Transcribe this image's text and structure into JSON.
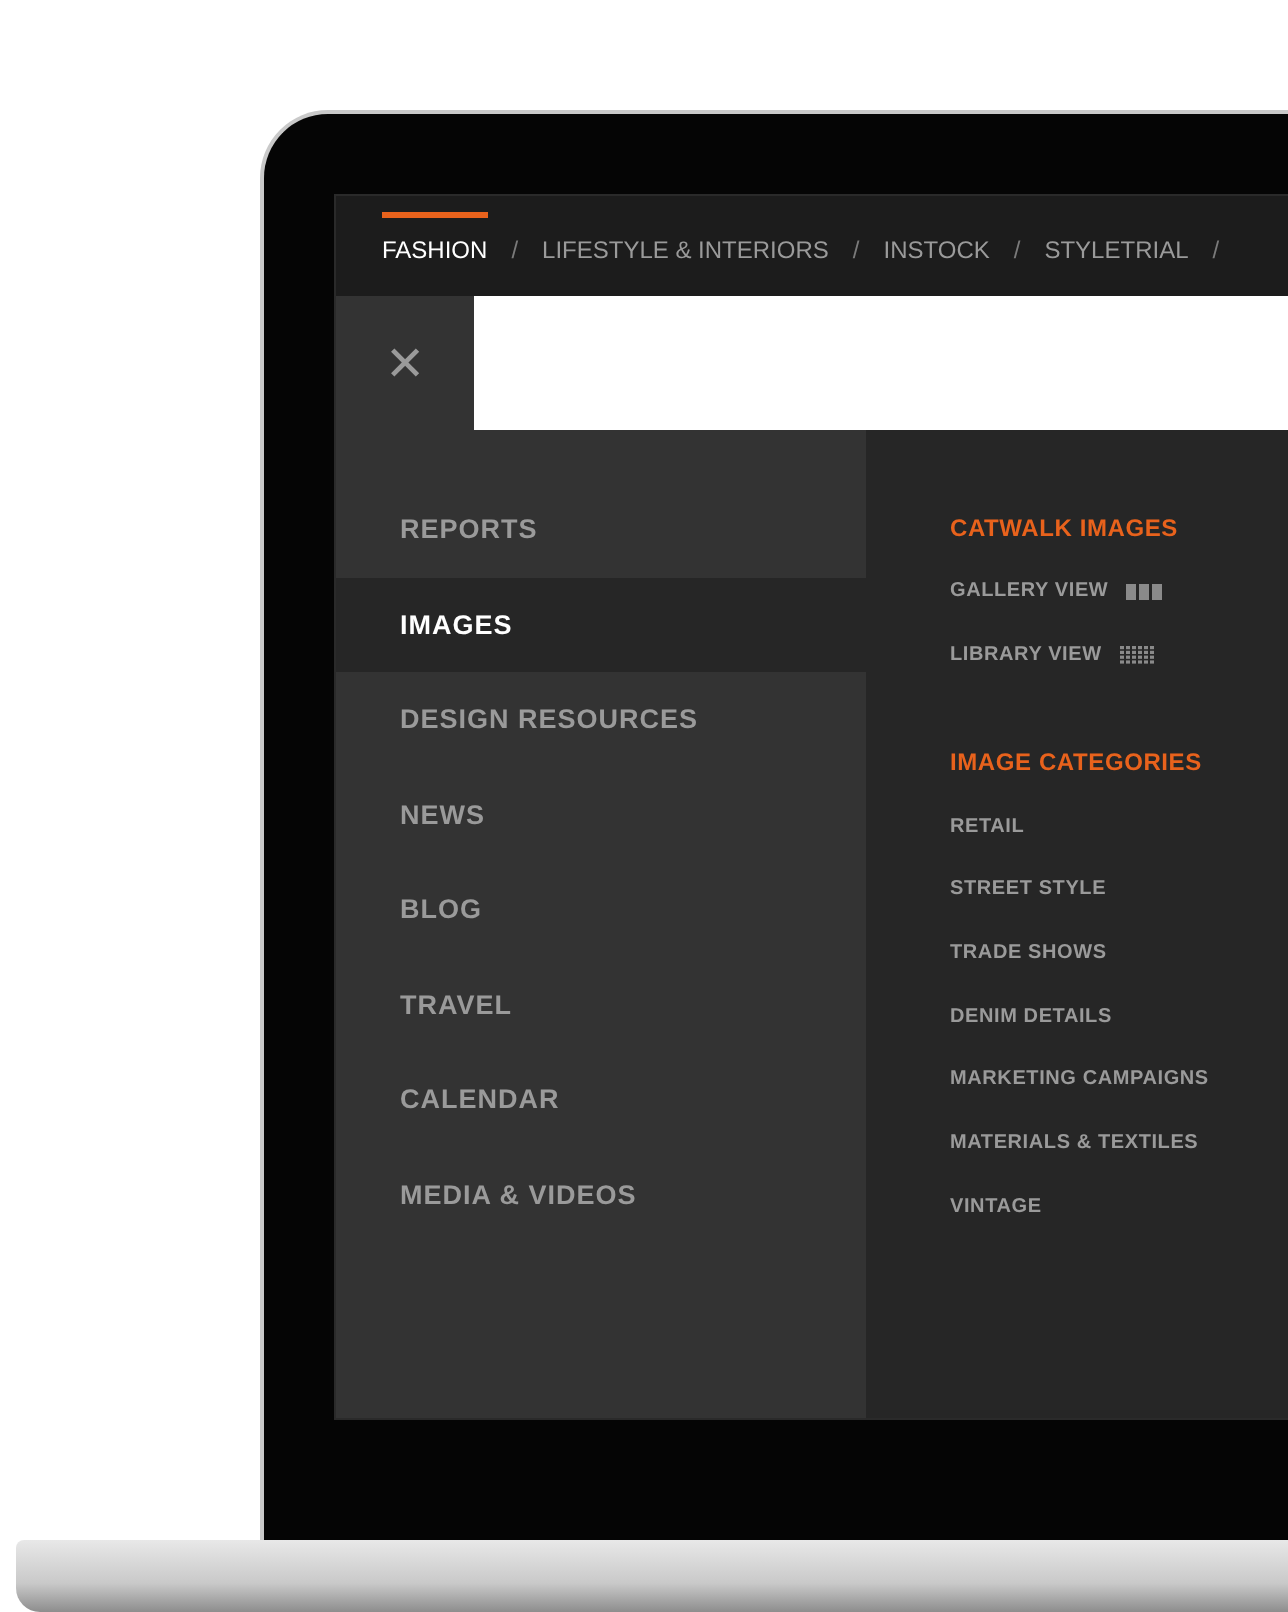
{
  "nav_tabs": [
    {
      "label": "FASHION",
      "selected": true
    },
    {
      "label": "LIFESTYLE & INTERIORS",
      "selected": false
    },
    {
      "label": "INSTOCK",
      "selected": false
    },
    {
      "label": "STYLETRIAL",
      "selected": false
    }
  ],
  "nav_separator": "/",
  "close_button": "✕",
  "menu": {
    "items": [
      {
        "label": "REPORTS",
        "selected": false
      },
      {
        "label": "IMAGES",
        "selected": true
      },
      {
        "label": "DESIGN RESOURCES",
        "selected": false
      },
      {
        "label": "NEWS",
        "selected": false
      },
      {
        "label": "BLOG",
        "selected": false
      },
      {
        "label": "TRAVEL",
        "selected": false
      },
      {
        "label": "CALENDAR",
        "selected": false
      },
      {
        "label": "MEDIA & VIDEOS",
        "selected": false
      }
    ]
  },
  "submenu": [
    {
      "heading": "CATWALK IMAGES",
      "links": [
        {
          "label": "GALLERY VIEW",
          "kind": "gallery"
        },
        {
          "label": "LIBRARY VIEW",
          "kind": "library"
        }
      ]
    },
    {
      "heading": "IMAGE CATEGORIES",
      "links": [
        {
          "label": "RETAIL"
        },
        {
          "label": "STREET STYLE"
        },
        {
          "label": "TRADE SHOWS"
        },
        {
          "label": "DENIM DETAILS"
        },
        {
          "label": "MARKETING CAMPAIGNS"
        },
        {
          "label": "MATERIALS & TEXTILES"
        },
        {
          "label": "VINTAGE"
        }
      ]
    }
  ]
}
